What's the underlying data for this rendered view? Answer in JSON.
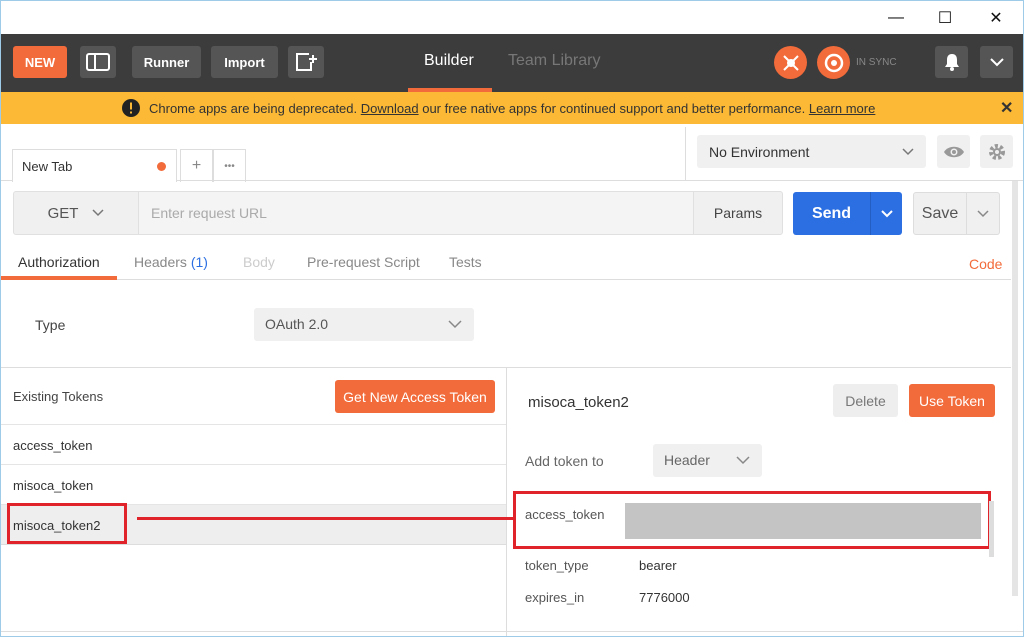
{
  "window": {
    "controls": {
      "minimize": "—",
      "maximize": "☐",
      "close": "✕"
    }
  },
  "header": {
    "new_label": "NEW",
    "runner_label": "Runner",
    "import_label": "Import",
    "tabs": [
      {
        "label": "Builder",
        "active": true
      },
      {
        "label": "Team Library",
        "active": false
      }
    ],
    "sync_status": "IN SYNC",
    "accent": "#f26b3a"
  },
  "banner": {
    "text_before": "Chrome apps are being deprecated.",
    "download_link": "Download",
    "text_after": "our free native apps for continued support and better performance.",
    "learn_more": "Learn more",
    "close": "✕",
    "bg": "#fbb935"
  },
  "tabs": {
    "request_tab": "New Tab",
    "add": "+",
    "more": "•••"
  },
  "environment": {
    "selected": "No Environment"
  },
  "request": {
    "method": "GET",
    "url_placeholder": "Enter request URL",
    "params_label": "Params",
    "send_label": "Send",
    "save_label": "Save"
  },
  "subtabs": [
    {
      "label": "Authorization",
      "state": "active"
    },
    {
      "label": "Headers",
      "count": "(1)",
      "state": "normal"
    },
    {
      "label": "Body",
      "state": "disabled"
    },
    {
      "label": "Pre-request Script",
      "state": "normal"
    },
    {
      "label": "Tests",
      "state": "normal"
    }
  ],
  "code_link": "Code",
  "auth": {
    "type_label": "Type",
    "type_value": "OAuth 2.0"
  },
  "tokens": {
    "heading": "Existing Tokens",
    "get_new_label": "Get New Access Token",
    "items": [
      "access_token",
      "misoca_token",
      "misoca_token2"
    ],
    "selected_index": 2
  },
  "token_detail": {
    "name": "misoca_token2",
    "delete_label": "Delete",
    "use_label": "Use Token",
    "add_token_to_label": "Add token to",
    "add_token_to_value": "Header",
    "fields": [
      {
        "key": "access_token",
        "value": ""
      },
      {
        "key": "token_type",
        "value": "bearer"
      },
      {
        "key": "expires_in",
        "value": "7776000"
      }
    ]
  }
}
